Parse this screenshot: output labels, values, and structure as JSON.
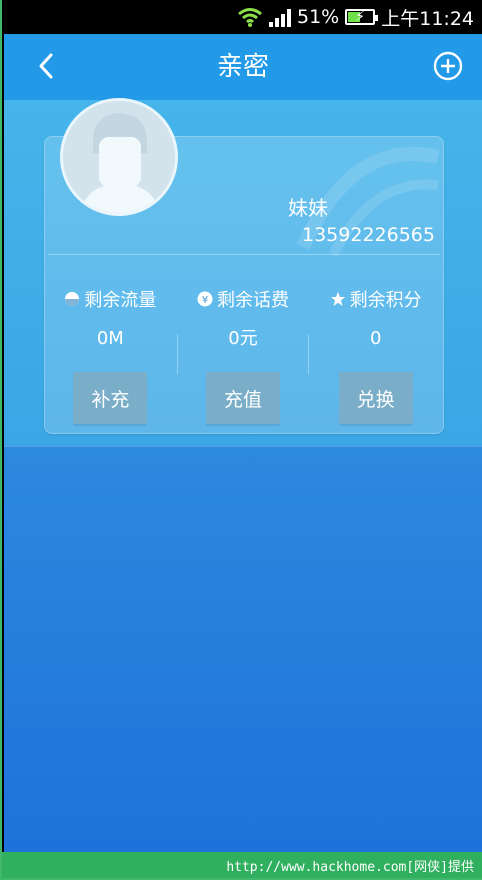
{
  "status_bar": {
    "battery_percent": "51%",
    "time": "上午11:24",
    "icons": [
      "wifi-icon",
      "signal-icon",
      "battery-icon"
    ]
  },
  "header": {
    "title": "亲密",
    "back_icon": "chevron-left-icon",
    "add_icon": "plus-circle-icon"
  },
  "profile": {
    "name": "妹妹",
    "phone": "13592226565"
  },
  "stats": [
    {
      "label": "剩余流量",
      "value": "0M",
      "icon": "pie-icon",
      "action": "补充"
    },
    {
      "label": "剩余话费",
      "value": "0元",
      "icon": "yuan-icon",
      "action": "充值"
    },
    {
      "label": "剩余积分",
      "value": "0",
      "icon": "star-icon",
      "action": "兑换"
    }
  ],
  "footer": {
    "text": "http://www.hackhome.com[网侠]提供"
  },
  "colors": {
    "accent": "#239ae8",
    "background_top": "#3ea6e3",
    "background_bottom": "#1f72d9",
    "button": "#7aaec8",
    "footer": "#30b05f"
  }
}
